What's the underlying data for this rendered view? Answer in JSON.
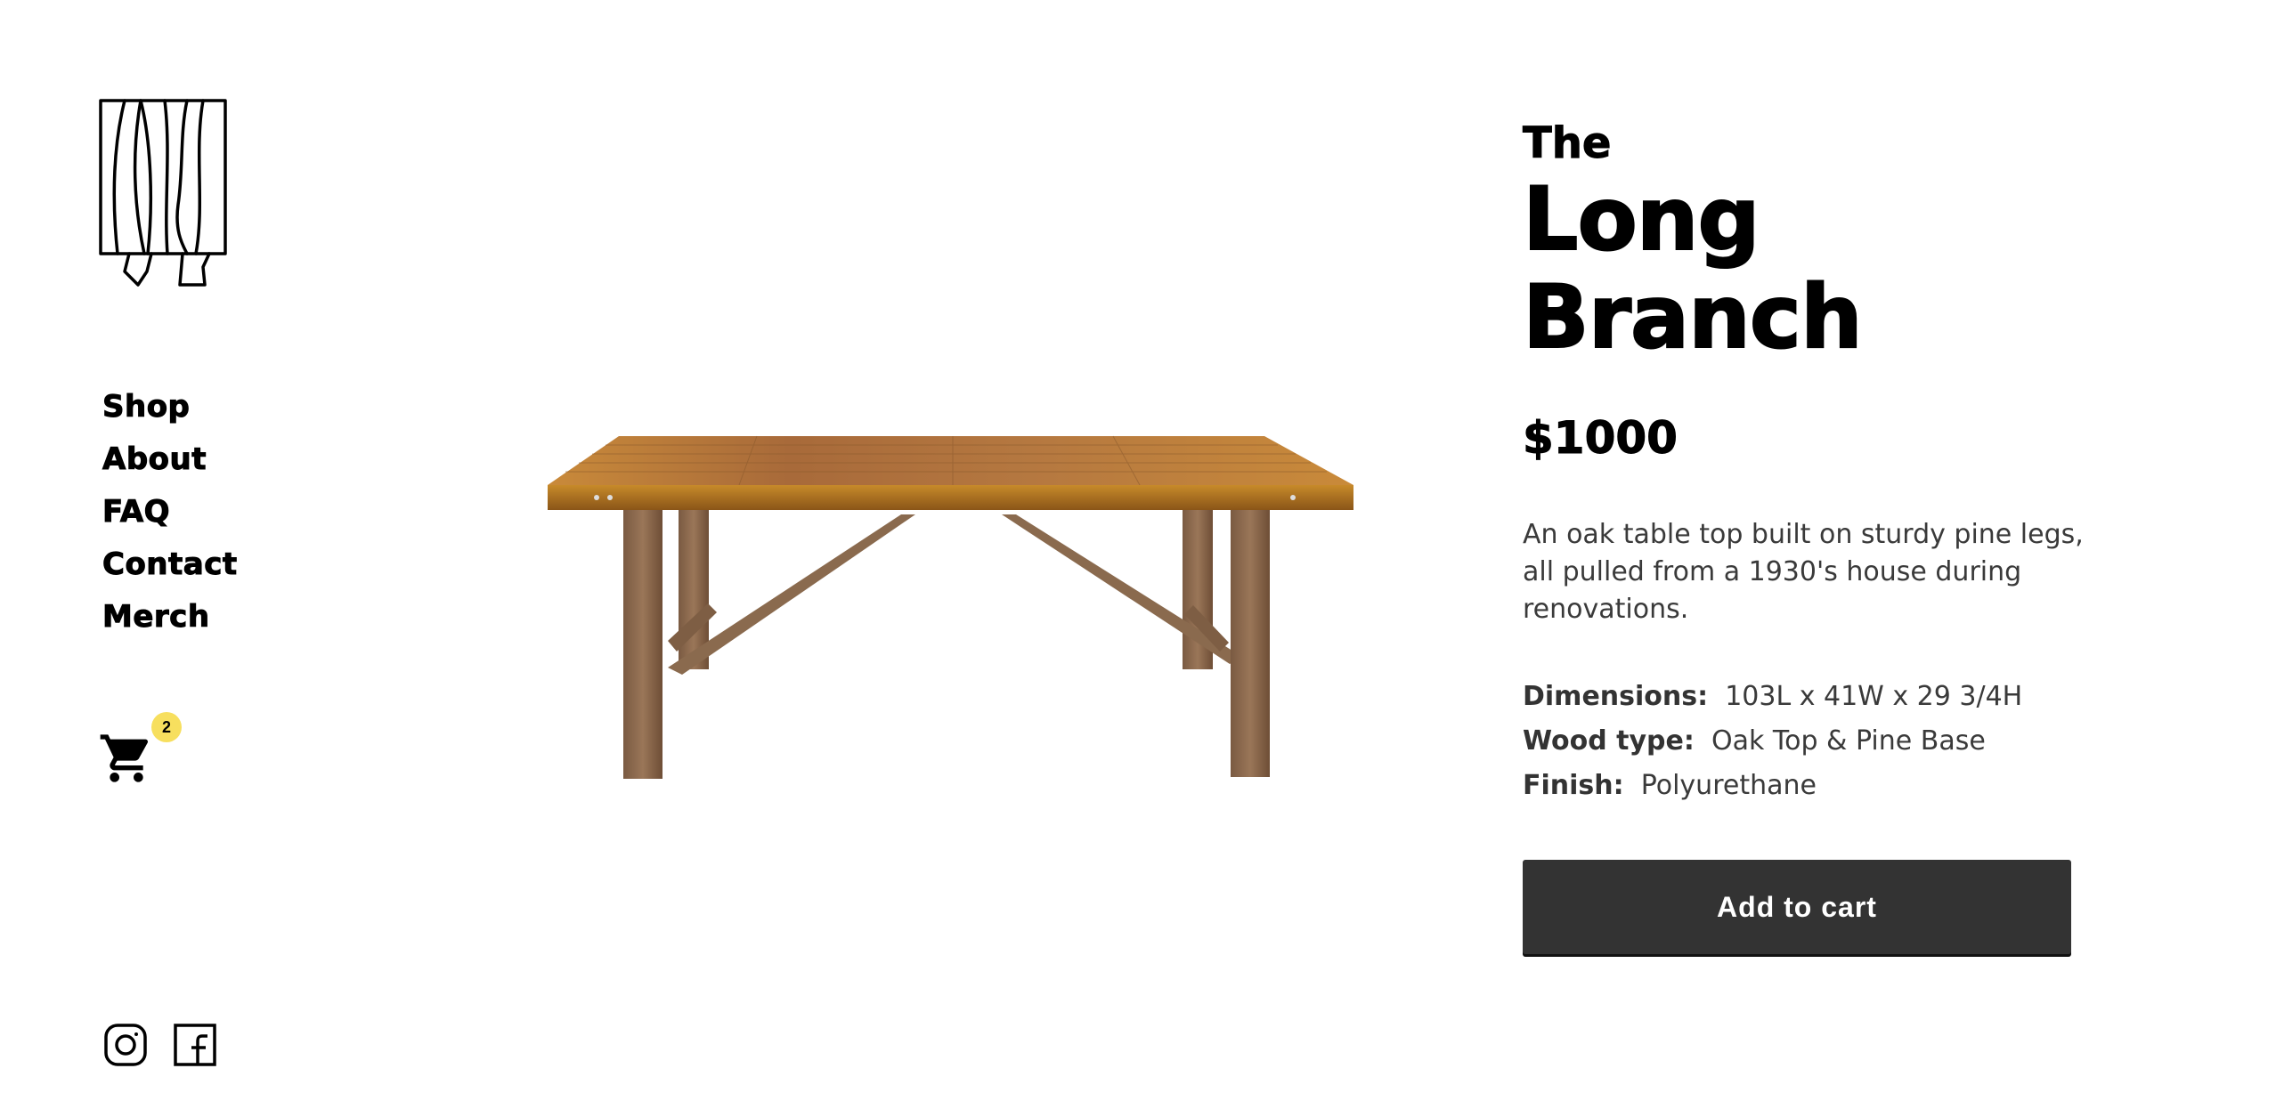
{
  "nav": {
    "items": [
      "Shop",
      "About",
      "FAQ",
      "Contact",
      "Merch"
    ]
  },
  "cart": {
    "count": "2",
    "badge_color": "#f7df5e"
  },
  "social": {
    "icons": [
      "instagram-icon",
      "facebook-icon"
    ]
  },
  "product": {
    "title_pre": "The",
    "title": "Long Branch",
    "price": "$1000",
    "description": "An oak table top built on sturdy pine legs, all pulled from a 1930's house during renovations.",
    "specs": [
      {
        "label": "Dimensions:",
        "value": "103L x 41W x 29 3/4H"
      },
      {
        "label": "Wood type:",
        "value": "Oak Top & Pine Base"
      },
      {
        "label": "Finish:",
        "value": "Polyurethane"
      }
    ],
    "add_to_cart_label": "Add to cart",
    "button_color": "#333333"
  }
}
